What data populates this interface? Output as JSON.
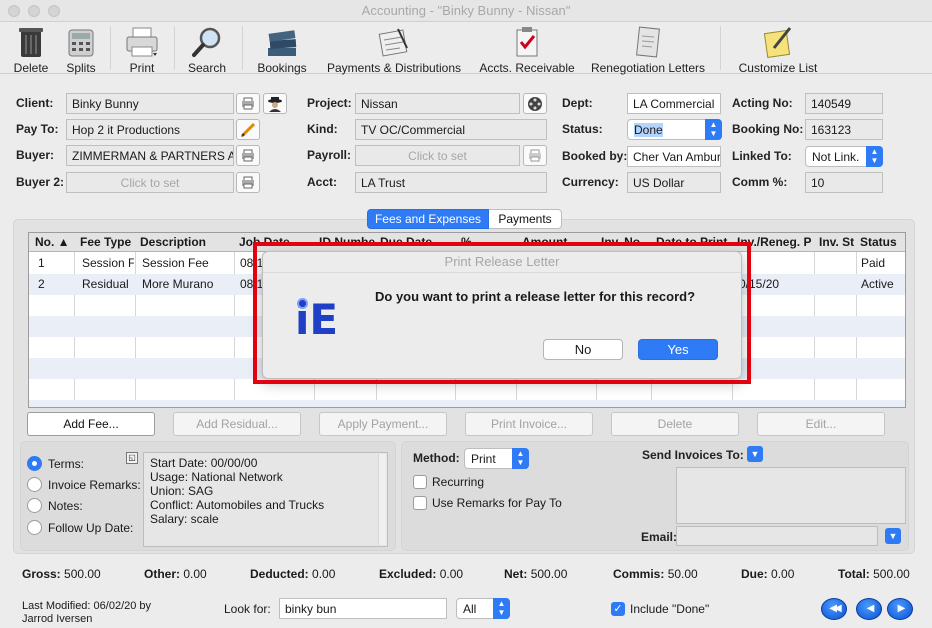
{
  "window": {
    "title": "Accounting - \"Binky Bunny - Nissan\""
  },
  "toolbar": {
    "delete": "Delete",
    "splits": "Splits",
    "print": "Print",
    "search": "Search",
    "bookings": "Bookings",
    "payments": "Payments & Distributions",
    "accts": "Accts. Receivable",
    "reneg": "Renegotiation Letters",
    "customize": "Customize List"
  },
  "form": {
    "client_label": "Client:",
    "client_value": "Binky Bunny",
    "payto_label": "Pay To:",
    "payto_value": "Hop 2 it Productions",
    "buyer_label": "Buyer:",
    "buyer_value": "ZIMMERMAN & PARTNERS ADV",
    "buyer2_label": "Buyer 2:",
    "buyer2_placeholder": "Click to set",
    "project_label": "Project:",
    "project_value": "Nissan",
    "kind_label": "Kind:",
    "kind_value": "TV OC/Commercial",
    "payroll_label": "Payroll:",
    "payroll_placeholder": "Click to set",
    "acct_label": "Acct:",
    "acct_value": "LA Trust",
    "dept_label": "Dept:",
    "dept_value": "LA Commercial",
    "status_label": "Status:",
    "status_value": "Done",
    "bookedby_label": "Booked by:",
    "bookedby_value": "Cher Van Ambur",
    "currency_label": "Currency:",
    "currency_value": "US Dollar",
    "acting_label": "Acting No:",
    "acting_value": "140549",
    "booking_label": "Booking No:",
    "booking_value": "163123",
    "linked_label": "Linked To:",
    "linked_value": "Not Link.",
    "comm_label": "Comm %:",
    "comm_value": "10"
  },
  "tabs": {
    "fees": "Fees and Expenses",
    "payments": "Payments"
  },
  "grid": {
    "headers": [
      "No. ▲",
      "Fee Type",
      "Description",
      "Job Date",
      "ID Number",
      "Due Date",
      "%",
      "Amount",
      "Inv. No.",
      "Date to Print",
      "Inv./Reneg. P",
      "Inv. St",
      "Status"
    ],
    "rows": [
      [
        "1",
        "Session F",
        "Session Fee",
        "08/1",
        "",
        "",
        "",
        "",
        "",
        "",
        "",
        "",
        "Paid"
      ],
      [
        "2",
        "Residual",
        "More Murano",
        "08/1",
        "",
        "",
        "",
        "",
        "",
        "",
        "0/15/20",
        "",
        "Active"
      ]
    ]
  },
  "actions": {
    "add_fee": "Add Fee...",
    "add_residual": "Add Residual...",
    "apply_payment": "Apply Payment...",
    "print_invoice": "Print Invoice...",
    "delete": "Delete",
    "edit": "Edit..."
  },
  "notes": {
    "terms": "Terms:",
    "invoice_remarks": "Invoice Remarks:",
    "notes": "Notes:",
    "follow_up": "Follow Up Date:",
    "text_lines": [
      "Start Date: 00/00/00",
      "Usage: National Network",
      "Union: SAG",
      "Conflict: Automobiles and Trucks",
      "Salary: scale"
    ]
  },
  "invoice": {
    "method_label": "Method:",
    "method_value": "Print",
    "recurring": "Recurring",
    "use_remarks": "Use Remarks for Pay To",
    "send_label": "Send Invoices To:",
    "email_label": "Email:"
  },
  "totals": {
    "gross_label": "Gross:",
    "gross": "500.00",
    "other_label": "Other:",
    "other": "0.00",
    "deducted_label": "Deducted:",
    "deducted": "0.00",
    "excluded_label": "Excluded:",
    "excluded": "0.00",
    "net_label": "Net:",
    "net": "500.00",
    "commis_label": "Commis:",
    "commis": "50.00",
    "due_label": "Due:",
    "due": "0.00",
    "total_label": "Total:",
    "total": "500.00"
  },
  "footer": {
    "modified_line1": "Last Modified: 06/02/20 by",
    "modified_line2": "Jarrod Iversen",
    "lookfor_label": "Look for:",
    "lookfor_value": "binky bun",
    "scope_value": "All",
    "include_done": "Include \"Done\""
  },
  "dialog": {
    "title": "Print Release Letter",
    "message": "Do you want to print a release letter for this record?",
    "no": "No",
    "yes": "Yes",
    "logo_text": "iE"
  },
  "colors": {
    "accent": "#2f7bf5",
    "highlight": "#e3000f"
  }
}
